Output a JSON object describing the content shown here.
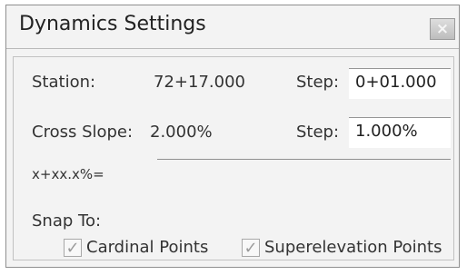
{
  "dialog": {
    "title": "Dynamics Settings",
    "close_icon": "close-icon"
  },
  "station": {
    "label": "Station:",
    "value": "72+17.000",
    "step_label": "Step:",
    "step_value": "0+01.000"
  },
  "cross_slope": {
    "label": "Cross Slope:",
    "value": "2.000%",
    "step_label": "Step:",
    "step_value": "1.000%"
  },
  "expression": {
    "label": "x+xx.x%="
  },
  "snap_to": {
    "label": "Snap To:",
    "options": [
      {
        "label": "Cardinal Points",
        "checked": true
      },
      {
        "label": "Superelevation Points",
        "checked": true
      }
    ]
  },
  "colors": {
    "background": "#f3f3f3",
    "border": "#8f8f8f",
    "text": "#333333"
  }
}
